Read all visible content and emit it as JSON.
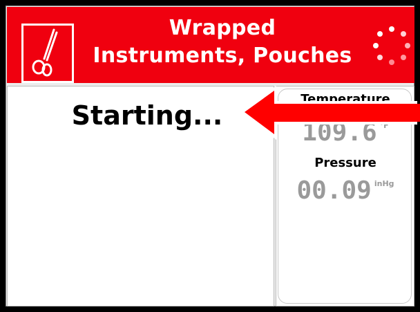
{
  "header": {
    "title_line1": "Wrapped",
    "title_line2": "Instruments, Pouches",
    "icon": "scissors-icon",
    "spinner_icon": "loading-spinner-icon",
    "background_color": "#f0000f"
  },
  "status": {
    "text": "Starting..."
  },
  "readings": {
    "temperature": {
      "label": "Temperature",
      "value": "109.6",
      "unit": "°F"
    },
    "pressure": {
      "label": "Pressure",
      "value": "00.09",
      "unit": "inHg"
    }
  },
  "annotation": {
    "arrow_color": "#ff0000",
    "icon": "pointer-arrow-icon"
  }
}
